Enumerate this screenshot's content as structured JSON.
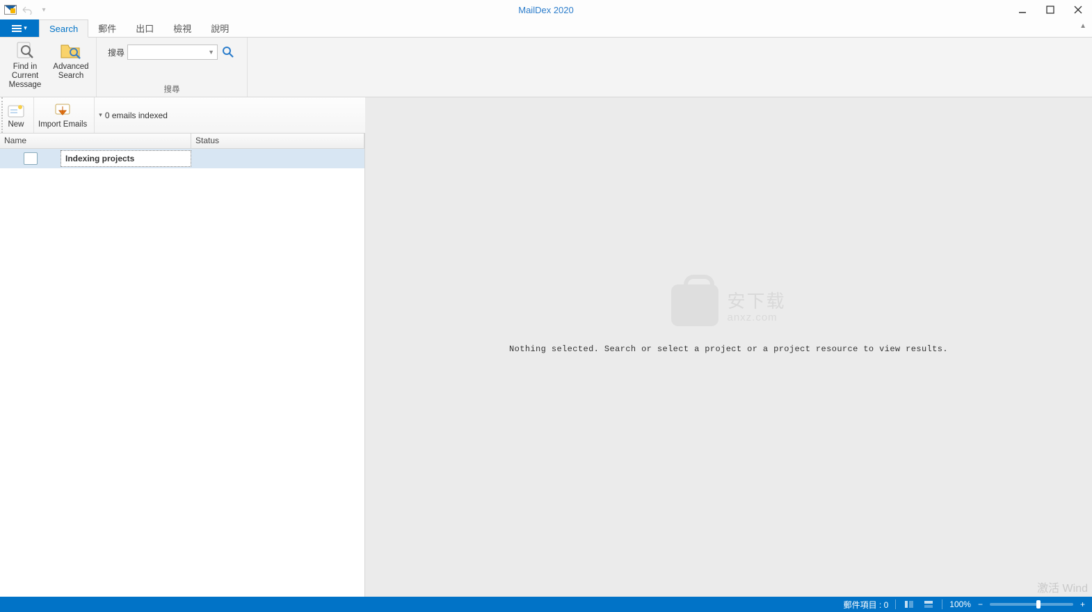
{
  "title": "MailDex 2020",
  "tabs": {
    "file": "▤",
    "search": "Search",
    "mail": "郵件",
    "export": "出口",
    "view": "檢視",
    "help": "說明"
  },
  "ribbon": {
    "find_label": "Find in Current Message",
    "adv_label": "Advanced Search",
    "search_label": "搜尋",
    "group_label": "搜尋"
  },
  "secondary": {
    "new": "New",
    "import": "Import Emails",
    "indexed": "0 emails indexed"
  },
  "grid": {
    "col_name": "Name",
    "col_status": "Status",
    "row0_name": "Indexing projects"
  },
  "right": {
    "wm_main": "安下载",
    "wm_sub": "anxz.com",
    "placeholder": "Nothing selected. Search or select a project or a project resource to view results."
  },
  "status": {
    "mail_items": "郵件項目 : 0",
    "zoom": "100%"
  },
  "ghost": "激活 Wind"
}
